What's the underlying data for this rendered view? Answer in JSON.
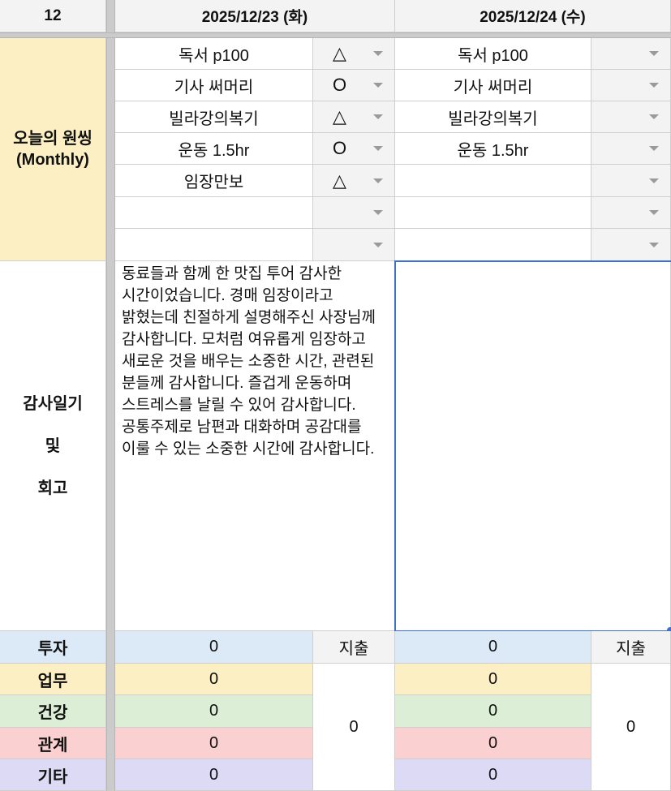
{
  "header": {
    "month": "12",
    "day1": "2025/12/23 (화)",
    "day2": "2025/12/24 (수)"
  },
  "labels": {
    "oneshot_line1": "오늘의 원씽",
    "oneshot_line2": "(Monthly)",
    "gratitude_line1": "감사일기",
    "gratitude_line2": "및",
    "gratitude_line3": "회고",
    "invest": "투자",
    "work": "업무",
    "health": "건강",
    "relation": "관계",
    "etc": "기타",
    "expense": "지출"
  },
  "day1_tasks": [
    {
      "task": "독서 p100",
      "mark": "△"
    },
    {
      "task": "기사 써머리",
      "mark": "O"
    },
    {
      "task": "빌라강의복기",
      "mark": "△"
    },
    {
      "task": "운동 1.5hr",
      "mark": "O"
    },
    {
      "task": "임장만보",
      "mark": "△"
    },
    {
      "task": "",
      "mark": ""
    },
    {
      "task": "",
      "mark": ""
    }
  ],
  "day2_tasks": [
    {
      "task": "독서 p100",
      "mark": ""
    },
    {
      "task": "기사 써머리",
      "mark": ""
    },
    {
      "task": "빌라강의복기",
      "mark": ""
    },
    {
      "task": "운동 1.5hr",
      "mark": ""
    },
    {
      "task": "",
      "mark": ""
    },
    {
      "task": "",
      "mark": ""
    },
    {
      "task": "",
      "mark": ""
    }
  ],
  "day1_gratitude": "동료들과 함께 한 맛집 투어 감사한 시간이었습니다. 경매 임장이라고 밝혔는데 친절하게 설명해주신 사장님께 감사합니다. 모처럼 여유롭게 임장하고 새로운 것을 배우는 소중한 시간, 관련된 분들께 감사합니다. 즐겁게 운동하며 스트레스를 날릴 수 있어 감사합니다. 공통주제로 남편과 대화하며 공감대를 이룰 수 있는 소중한 시간에 감사합니다.",
  "day2_gratitude": "",
  "day1_money": {
    "invest": "0",
    "work": "0",
    "health": "0",
    "relation": "0",
    "etc": "0",
    "expense": "0"
  },
  "day2_money": {
    "invest": "0",
    "work": "0",
    "health": "0",
    "relation": "0",
    "etc": "0",
    "expense": "0"
  },
  "colors": {
    "oneshot_bg": "#fdefc4",
    "invest_bg": "#dce9f6",
    "work_bg": "#fdefc4",
    "health_bg": "#dcefd6",
    "relation_bg": "#fbd0d0",
    "etc_bg": "#dcdaf5",
    "selection": "#3b6fd6"
  }
}
